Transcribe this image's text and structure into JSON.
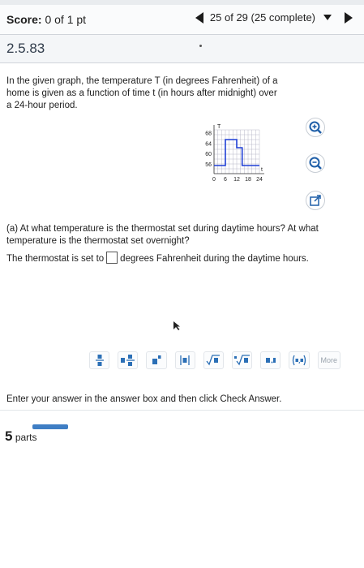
{
  "header": {
    "score_label": "Score:",
    "score_value": "0 of 1 pt",
    "progress": "25 of 29 (25 complete)"
  },
  "question": {
    "number": "2.5.83",
    "text": "In the given graph, the temperature T (in degrees Fahrenheit) of a home is given as a function of time t (in hours after midnight) over a 24-hour period."
  },
  "graph": {
    "y_axis_label": "T",
    "x_axis_label": "t",
    "y_ticks": [
      "68",
      "64",
      "60",
      "56"
    ],
    "x_ticks": [
      "0",
      "6",
      "12",
      "18",
      "24"
    ],
    "line_color": "#1f3fd6"
  },
  "part_a": {
    "question": "(a) At what temperature is the thermostat set during daytime hours? At what temperature is the thermostat set overnight?",
    "answer_prefix": "The thermostat is set to",
    "answer_suffix": "degrees Fahrenheit during the daytime hours."
  },
  "palette": {
    "more_label": "More"
  },
  "footer": {
    "instruction": "Enter your answer in the answer box and then click Check Answer.",
    "parts_count": "5",
    "parts_label": "parts"
  }
}
